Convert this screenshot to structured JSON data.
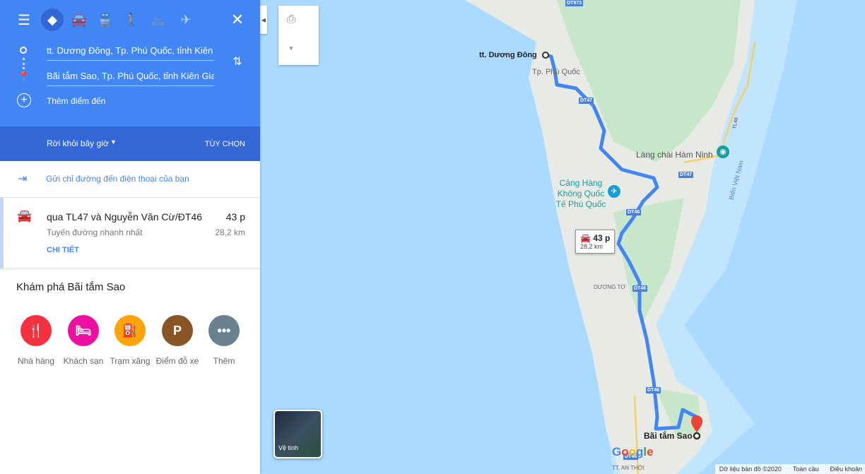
{
  "header": {
    "origin": "tt. Dương Đông, Tp. Phú Quốc, tỉnh Kiên Giang",
    "destination": "Bãi tắm Sao, Tp. Phú Quốc, tỉnh Kiên Giang",
    "add_destination": "Thêm điểm đến",
    "selected_mode": "best"
  },
  "depart": {
    "label": "Rời khỏi bây giờ",
    "options": "TÙY CHỌN"
  },
  "send": "Gửi chỉ đường đến điện thoại của bạn",
  "route": {
    "via": "qua TL47 và Nguyễn Văn Cừ/ĐT46",
    "time": "43 p",
    "note": "Tuyến đường nhanh nhất",
    "distance": "28,2 km",
    "details": "CHI TIẾT"
  },
  "explore": {
    "title": "Khám phá Bãi tắm Sao",
    "items": [
      {
        "label": "Nhà hàng",
        "color": "#f4323f"
      },
      {
        "label": "Khách sạn",
        "color": "#ed0f9f"
      },
      {
        "label": "Trạm xăng",
        "color": "#fea30a"
      },
      {
        "label": "Điểm đỗ xe",
        "color": "#8a5524"
      },
      {
        "label": "Thêm",
        "color": "#6a8190"
      }
    ]
  },
  "map": {
    "labels": {
      "origin": "tt. Dương Đông",
      "city": "Tp. Phú Quốc",
      "village": "Làng chài Hàm Ninh",
      "airport": "Cảng Hàng Không Quốc Tế Phú Quốc",
      "duongto": "DƯƠNG TƠ",
      "dest": "Bãi tắm Sao",
      "anthoi": "TT. AN THỜI",
      "sea": "Biển Việt Nam"
    },
    "roads": [
      "DT973",
      "DT47",
      "DT47",
      "DT46",
      "DT46",
      "DT46",
      "DT46",
      "TL48"
    ],
    "bubble": {
      "time": "43 p",
      "distance": "28,2 km"
    },
    "satellite": "Vệ tinh",
    "footer": {
      "data": "Dữ liệu bản đồ ©2020",
      "global": "Toàn cầu",
      "terms": "Điều khoản"
    },
    "route_color": "#4285f4"
  }
}
